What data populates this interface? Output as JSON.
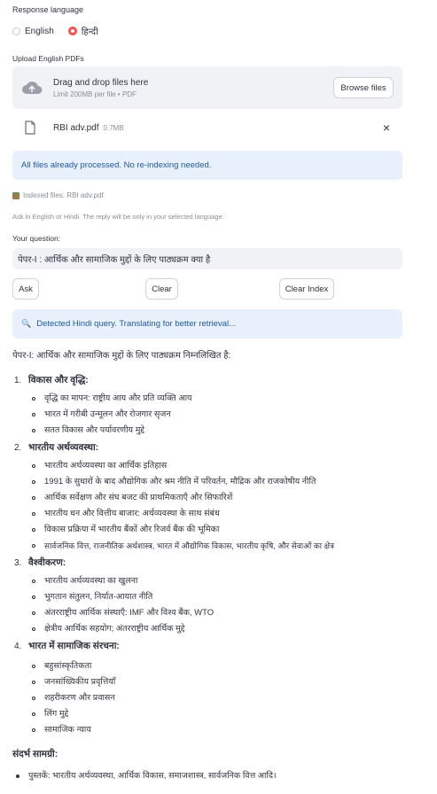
{
  "response_language": {
    "label": "Response language",
    "options": [
      {
        "label": "English",
        "selected": false
      },
      {
        "label": "हिन्दी",
        "selected": true
      }
    ]
  },
  "upload": {
    "label": "Upload English PDFs",
    "dropzone_title": "Drag and drop files here",
    "dropzone_limit": "Limit 200MB per file • PDF",
    "browse_label": "Browse files",
    "file_name": "RBI adv.pdf",
    "file_size": "0.7MB",
    "remove_icon": "×"
  },
  "status": {
    "processed_message": "All files already processed. No re-indexing needed.",
    "indexed_files": "Indexed files: RBI adv.pdf",
    "hint": "Ask in English or Hindi. The reply will be only in your selected language."
  },
  "question": {
    "label": "Your question:",
    "value": "पेपर-I : आर्थिक और सामाजिक मुद्दों के लिए पाठ्यक्रम क्या है"
  },
  "buttons": {
    "ask": "Ask",
    "clear": "Clear",
    "clear_index": "Clear Index"
  },
  "detected": {
    "icon": "🔍",
    "message": "Detected Hindi query. Translating for better retrieval..."
  },
  "answer": {
    "intro": "पेपर-I: आर्थिक और सामाजिक मुद्दों के लिए पाठ्यक्रम निम्नलिखित है:",
    "sections": [
      {
        "num": "1.",
        "title": "विकास और वृद्धि:",
        "items": [
          "वृद्धि का मापन: राष्ट्रीय आय और प्रति व्यक्ति आय",
          "भारत में गरीबी उन्मूलन और रोजगार सृजन",
          "सतत विकास और पर्यावरणीय मुद्दे"
        ]
      },
      {
        "num": "2.",
        "title": "भारतीय अर्थव्यवस्था:",
        "items": [
          "भारतीय अर्थव्यवस्था का आर्थिक इतिहास",
          "1991 के सुधारों के बाद औद्योगिक और श्रम नीति में परिवर्तन, मौद्रिक और राजकोषीय नीति",
          "आर्थिक सर्वेक्षण और संघ बजट की प्राथमिकताएँ और सिफारिशें",
          "भारतीय धन और वित्तीय बाजार: अर्थव्यवस्था के साथ संबंध",
          "विकास प्रक्रिया में भारतीय बैंकों और रिजर्व बैंक की भूमिका",
          "सार्वजनिक वित्त, राजनीतिक अर्थशास्त्र, भारत में औद्योगिक विकास, भारतीय कृषि, और सेवाओं का क्षेत्र"
        ]
      },
      {
        "num": "3.",
        "title": "वैश्वीकरण:",
        "items": [
          "भारतीय अर्थव्यवस्था का खुलना",
          "भुगतान संतुलन, निर्यात-आयात नीति",
          "अंतरराष्ट्रीय आर्थिक संस्थाएँ: IMF और विश्व बैंक, WTO",
          "क्षेत्रीय आर्थिक सहयोग; अंतरराष्ट्रीय आर्थिक मुद्दे"
        ]
      },
      {
        "num": "4.",
        "title": "भारत में सामाजिक संरचना:",
        "items": [
          "बहुसांस्कृतिकता",
          "जनसांख्यिकीय प्रवृत्तियाँ",
          "शहरीकरण और प्रवासन",
          "लिंग मुद्दे",
          "सामाजिक न्याय"
        ]
      }
    ],
    "refs_title": "संदर्भ सामग्री:",
    "refs_item": "पुस्तकें: भारतीय अर्थव्यवस्था, आर्थिक विकास, समाजशास्त्र, सार्वजनिक वित्त आदि।"
  }
}
